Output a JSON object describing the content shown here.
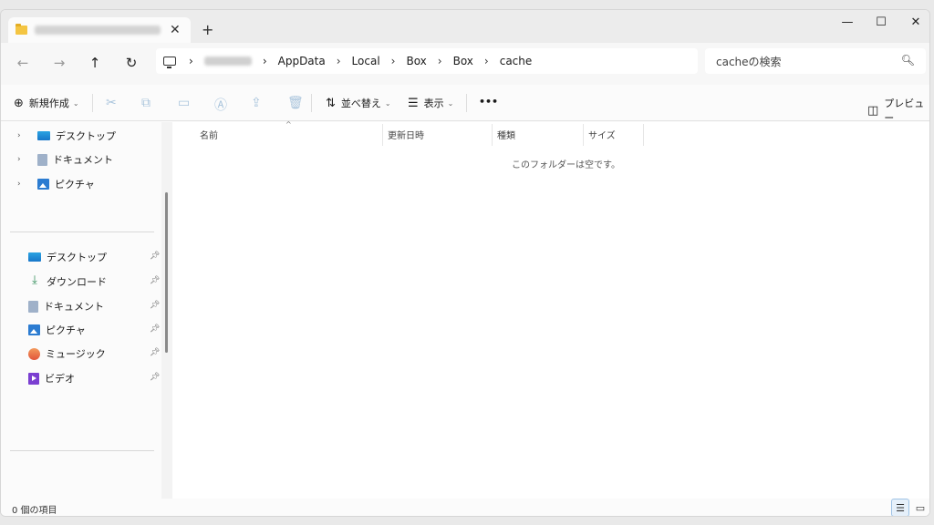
{
  "window": {
    "tab_close": "✕",
    "new_tab": "+",
    "minimize": "—",
    "maximize": "☐",
    "close": "✕"
  },
  "nav": {
    "back": "←",
    "forward": "→",
    "up": "↑",
    "refresh": "↻",
    "breadcrumb": [
      "AppData",
      "Local",
      "Box",
      "Box",
      "cache"
    ],
    "separator": "›"
  },
  "search": {
    "placeholder": "cacheの検索",
    "icon": "search-icon"
  },
  "toolbar": {
    "new_label": "新規作成",
    "sort_label": "並べ替え",
    "view_label": "表示",
    "more_label": "•••",
    "preview_label": "プレビュー"
  },
  "sidebar": {
    "tree": [
      {
        "label": "デスクトップ",
        "icon": "desktop-icon"
      },
      {
        "label": "ドキュメント",
        "icon": "documents-icon"
      },
      {
        "label": "ピクチャ",
        "icon": "pictures-icon"
      }
    ],
    "quick_access": [
      {
        "label": "デスクトップ",
        "icon": "desktop-icon"
      },
      {
        "label": "ダウンロード",
        "icon": "download-icon"
      },
      {
        "label": "ドキュメント",
        "icon": "documents-icon"
      },
      {
        "label": "ピクチャ",
        "icon": "pictures-icon"
      },
      {
        "label": "ミュージック",
        "icon": "music-icon"
      },
      {
        "label": "ビデオ",
        "icon": "video-icon"
      }
    ]
  },
  "columns": [
    "名前",
    "更新日時",
    "種類",
    "サイズ"
  ],
  "empty_message": "このフォルダーは空です。",
  "status": {
    "count": "0 個の項目"
  }
}
